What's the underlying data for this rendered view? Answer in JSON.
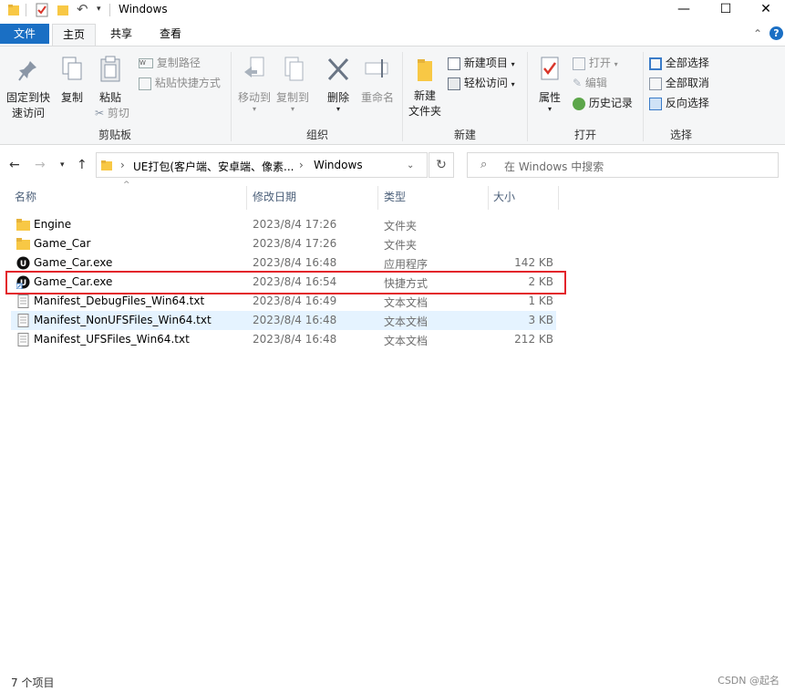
{
  "window": {
    "title": "Windows",
    "minimize": "—",
    "maximize": "☐",
    "close": "✕"
  },
  "ribbon_tabs": {
    "file": "文件",
    "home": "主页",
    "share": "共享",
    "view": "查看"
  },
  "ribbon": {
    "clipboard": {
      "pin": "固定到快\n速访问",
      "pin_line1": "固定到快",
      "pin_line2": "速访问",
      "copy": "复制",
      "paste": "粘贴",
      "copy_path": "复制路径",
      "paste_shortcut": "粘贴快捷方式",
      "cut": "剪切",
      "label": "剪贴板"
    },
    "organize": {
      "move_to": "移动到",
      "copy_to": "复制到",
      "delete": "删除",
      "rename": "重命名",
      "label": "组织"
    },
    "new": {
      "new_folder_line1": "新建",
      "new_folder_line2": "文件夹",
      "new_item": "新建项目",
      "easy_access": "轻松访问",
      "label": "新建"
    },
    "open": {
      "properties": "属性",
      "open": "打开",
      "edit": "编辑",
      "history": "历史记录",
      "label": "打开"
    },
    "select": {
      "select_all": "全部选择",
      "select_none": "全部取消",
      "invert": "反向选择",
      "label": "选择"
    }
  },
  "address": {
    "path_parent": "UE打包(客户端、安卓端、像素...",
    "separator": "›",
    "current": "Windows",
    "search_placeholder": "在 Windows 中搜索"
  },
  "columns": {
    "name": "名称",
    "date": "修改日期",
    "type": "类型",
    "size": "大小"
  },
  "files": [
    {
      "name": "Engine",
      "date": "2023/8/4 17:26",
      "type": "文件夹",
      "size": "",
      "icon": "folder-icon"
    },
    {
      "name": "Game_Car",
      "date": "2023/8/4 17:26",
      "type": "文件夹",
      "size": "",
      "icon": "folder-icon"
    },
    {
      "name": "Game_Car.exe",
      "date": "2023/8/4 16:48",
      "type": "应用程序",
      "size": "142 KB",
      "icon": "unreal-app-icon"
    },
    {
      "name": "Game_Car.exe",
      "date": "2023/8/4 16:54",
      "type": "快捷方式",
      "size": "2 KB",
      "icon": "unreal-shortcut-icon"
    },
    {
      "name": "Manifest_DebugFiles_Win64.txt",
      "date": "2023/8/4 16:49",
      "type": "文本文档",
      "size": "1 KB",
      "icon": "text-file-icon"
    },
    {
      "name": "Manifest_NonUFSFiles_Win64.txt",
      "date": "2023/8/4 16:48",
      "type": "文本文档",
      "size": "3 KB",
      "icon": "text-file-icon"
    },
    {
      "name": "Manifest_UFSFiles_Win64.txt",
      "date": "2023/8/4 16:48",
      "type": "文本文档",
      "size": "212 KB",
      "icon": "text-file-icon"
    }
  ],
  "status": {
    "count": "7 个项目"
  },
  "watermark": "CSDN @起名",
  "colors": {
    "accent": "#1a6fc4",
    "highlight_row": "#e5f3ff",
    "annotation_box": "#e3242b",
    "folder": "#f8c845"
  }
}
